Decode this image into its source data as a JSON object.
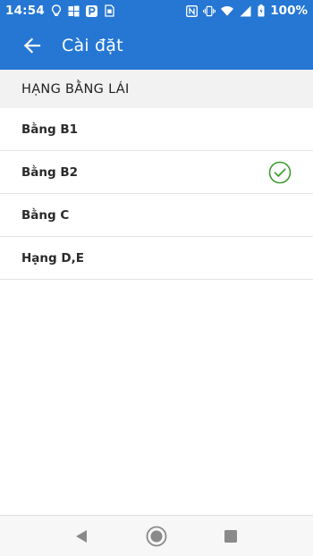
{
  "status_bar": {
    "time": "14:54",
    "battery_text": "100%",
    "left_icons": [
      "lightbulb-icon",
      "windows-icon",
      "parking-icon",
      "sim-icon"
    ],
    "right_icons": [
      "nfc-icon",
      "vibrate-icon",
      "wifi-icon",
      "signal-icon",
      "battery-icon"
    ]
  },
  "app_bar": {
    "title": "Cài đặt",
    "back_icon": "arrow-left-icon"
  },
  "section": {
    "header": "HẠNG BẰNG LÁI"
  },
  "options": [
    {
      "label": "Bằng B1",
      "selected": false
    },
    {
      "label": "Bằng B2",
      "selected": true
    },
    {
      "label": "Bằng C",
      "selected": false
    },
    {
      "label": "Hạng D,E",
      "selected": false
    }
  ],
  "nav_bar": {
    "icons": [
      "back-triangle-icon",
      "home-circle-icon",
      "recents-square-icon"
    ]
  },
  "colors": {
    "primary": "#2577d3",
    "check": "#3e9a2f",
    "section_bg": "#f2f2f2",
    "divider": "#e3e3e3"
  }
}
